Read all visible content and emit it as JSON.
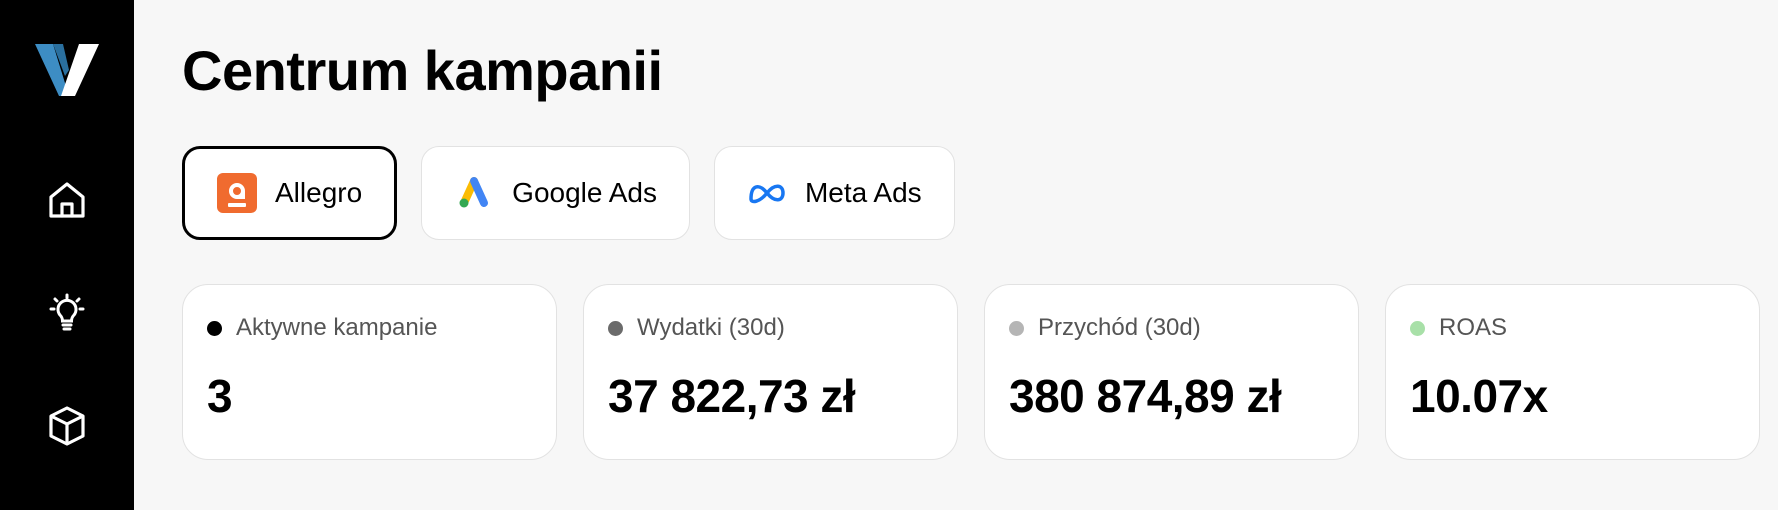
{
  "sidebar": {
    "logo": "v-logo",
    "items": [
      {
        "icon": "home-icon"
      },
      {
        "icon": "lightbulb-icon"
      },
      {
        "icon": "cube-icon"
      }
    ]
  },
  "page": {
    "title": "Centrum kampanii"
  },
  "tabs": [
    {
      "label": "Allegro",
      "icon": "allegro-icon",
      "active": true
    },
    {
      "label": "Google Ads",
      "icon": "google-ads-icon",
      "active": false
    },
    {
      "label": "Meta Ads",
      "icon": "meta-icon",
      "active": false
    }
  ],
  "stats": [
    {
      "label": "Aktywne kampanie",
      "value": "3",
      "dot_color": "#000000"
    },
    {
      "label": "Wydatki (30d)",
      "value": "37 822,73 zł",
      "dot_color": "#6b6b6b"
    },
    {
      "label": "Przychód (30d)",
      "value": "380 874,89 zł",
      "dot_color": "#b5b5b5"
    },
    {
      "label": "ROAS",
      "value": "10.07x",
      "dot_color": "#a8e0a8"
    }
  ],
  "colors": {
    "sidebar_bg": "#000000",
    "page_bg": "#f7f7f7",
    "allegro_orange": "#f06b2f",
    "meta_blue": "#1877f2",
    "logo_blue": "#3d8dc4"
  }
}
